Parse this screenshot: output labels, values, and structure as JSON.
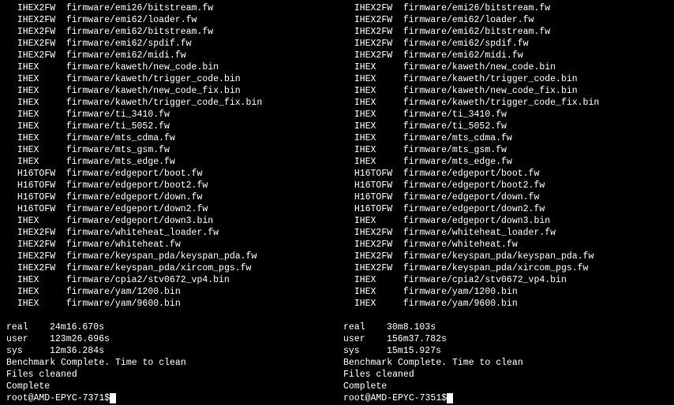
{
  "left": {
    "lines": [
      {
        "tag": "IHEX2FW",
        "path": "firmware/emi26/bitstream.fw"
      },
      {
        "tag": "IHEX2FW",
        "path": "firmware/emi62/loader.fw"
      },
      {
        "tag": "IHEX2FW",
        "path": "firmware/emi62/bitstream.fw"
      },
      {
        "tag": "IHEX2FW",
        "path": "firmware/emi62/spdif.fw"
      },
      {
        "tag": "IHEX2FW",
        "path": "firmware/emi62/midi.fw"
      },
      {
        "tag": "IHEX",
        "path": "firmware/kaweth/new_code.bin"
      },
      {
        "tag": "IHEX",
        "path": "firmware/kaweth/trigger_code.bin"
      },
      {
        "tag": "IHEX",
        "path": "firmware/kaweth/new_code_fix.bin"
      },
      {
        "tag": "IHEX",
        "path": "firmware/kaweth/trigger_code_fix.bin"
      },
      {
        "tag": "IHEX",
        "path": "firmware/ti_3410.fw"
      },
      {
        "tag": "IHEX",
        "path": "firmware/ti_5052.fw"
      },
      {
        "tag": "IHEX",
        "path": "firmware/mts_cdma.fw"
      },
      {
        "tag": "IHEX",
        "path": "firmware/mts_gsm.fw"
      },
      {
        "tag": "IHEX",
        "path": "firmware/mts_edge.fw"
      },
      {
        "tag": "H16TOFW",
        "path": "firmware/edgeport/boot.fw"
      },
      {
        "tag": "H16TOFW",
        "path": "firmware/edgeport/boot2.fw"
      },
      {
        "tag": "H16TOFW",
        "path": "firmware/edgeport/down.fw"
      },
      {
        "tag": "H16TOFW",
        "path": "firmware/edgeport/down2.fw"
      },
      {
        "tag": "IHEX",
        "path": "firmware/edgeport/down3.bin"
      },
      {
        "tag": "IHEX2FW",
        "path": "firmware/whiteheat_loader.fw"
      },
      {
        "tag": "IHEX2FW",
        "path": "firmware/whiteheat.fw"
      },
      {
        "tag": "IHEX2FW",
        "path": "firmware/keyspan_pda/keyspan_pda.fw"
      },
      {
        "tag": "IHEX2FW",
        "path": "firmware/keyspan_pda/xircom_pgs.fw"
      },
      {
        "tag": "IHEX",
        "path": "firmware/cpia2/stv0672_vp4.bin"
      },
      {
        "tag": "IHEX",
        "path": "firmware/yam/1200.bin"
      },
      {
        "tag": "IHEX",
        "path": "firmware/yam/9600.bin"
      }
    ],
    "timing": {
      "real": "24m16.670s",
      "user": "123m26.696s",
      "sys": "12m36.284s"
    },
    "benchmark_msg": "Benchmark Complete. Time to clean",
    "files_cleaned": "Files cleaned",
    "complete": "Complete",
    "prompt": "root@AMD-EPYC-7371$"
  },
  "right": {
    "lines": [
      {
        "tag": "IHEX2FW",
        "path": "firmware/emi26/bitstream.fw"
      },
      {
        "tag": "IHEX2FW",
        "path": "firmware/emi62/loader.fw"
      },
      {
        "tag": "IHEX2FW",
        "path": "firmware/emi62/bitstream.fw"
      },
      {
        "tag": "IHEX2FW",
        "path": "firmware/emi62/spdif.fw"
      },
      {
        "tag": "IHEX2FW",
        "path": "firmware/emi62/midi.fw"
      },
      {
        "tag": "IHEX",
        "path": "firmware/kaweth/new_code.bin"
      },
      {
        "tag": "IHEX",
        "path": "firmware/kaweth/trigger_code.bin"
      },
      {
        "tag": "IHEX",
        "path": "firmware/kaweth/new_code_fix.bin"
      },
      {
        "tag": "IHEX",
        "path": "firmware/kaweth/trigger_code_fix.bin"
      },
      {
        "tag": "IHEX",
        "path": "firmware/ti_3410.fw"
      },
      {
        "tag": "IHEX",
        "path": "firmware/ti_5052.fw"
      },
      {
        "tag": "IHEX",
        "path": "firmware/mts_cdma.fw"
      },
      {
        "tag": "IHEX",
        "path": "firmware/mts_gsm.fw"
      },
      {
        "tag": "IHEX",
        "path": "firmware/mts_edge.fw"
      },
      {
        "tag": "H16TOFW",
        "path": "firmware/edgeport/boot.fw"
      },
      {
        "tag": "H16TOFW",
        "path": "firmware/edgeport/boot2.fw"
      },
      {
        "tag": "H16TOFW",
        "path": "firmware/edgeport/down.fw"
      },
      {
        "tag": "H16TOFW",
        "path": "firmware/edgeport/down2.fw"
      },
      {
        "tag": "IHEX",
        "path": "firmware/edgeport/down3.bin"
      },
      {
        "tag": "IHEX2FW",
        "path": "firmware/whiteheat_loader.fw"
      },
      {
        "tag": "IHEX2FW",
        "path": "firmware/whiteheat.fw"
      },
      {
        "tag": "IHEX2FW",
        "path": "firmware/keyspan_pda/keyspan_pda.fw"
      },
      {
        "tag": "IHEX2FW",
        "path": "firmware/keyspan_pda/xircom_pgs.fw"
      },
      {
        "tag": "IHEX",
        "path": "firmware/cpia2/stv0672_vp4.bin"
      },
      {
        "tag": "IHEX",
        "path": "firmware/yam/1200.bin"
      },
      {
        "tag": "IHEX",
        "path": "firmware/yam/9600.bin"
      }
    ],
    "timing": {
      "real": "30m8.103s",
      "user": "156m37.782s",
      "sys": "15m15.927s"
    },
    "benchmark_msg": "Benchmark Complete. Time to clean",
    "files_cleaned": "Files cleaned",
    "complete": "Complete",
    "prompt": "root@AMD-EPYC-7351$"
  }
}
